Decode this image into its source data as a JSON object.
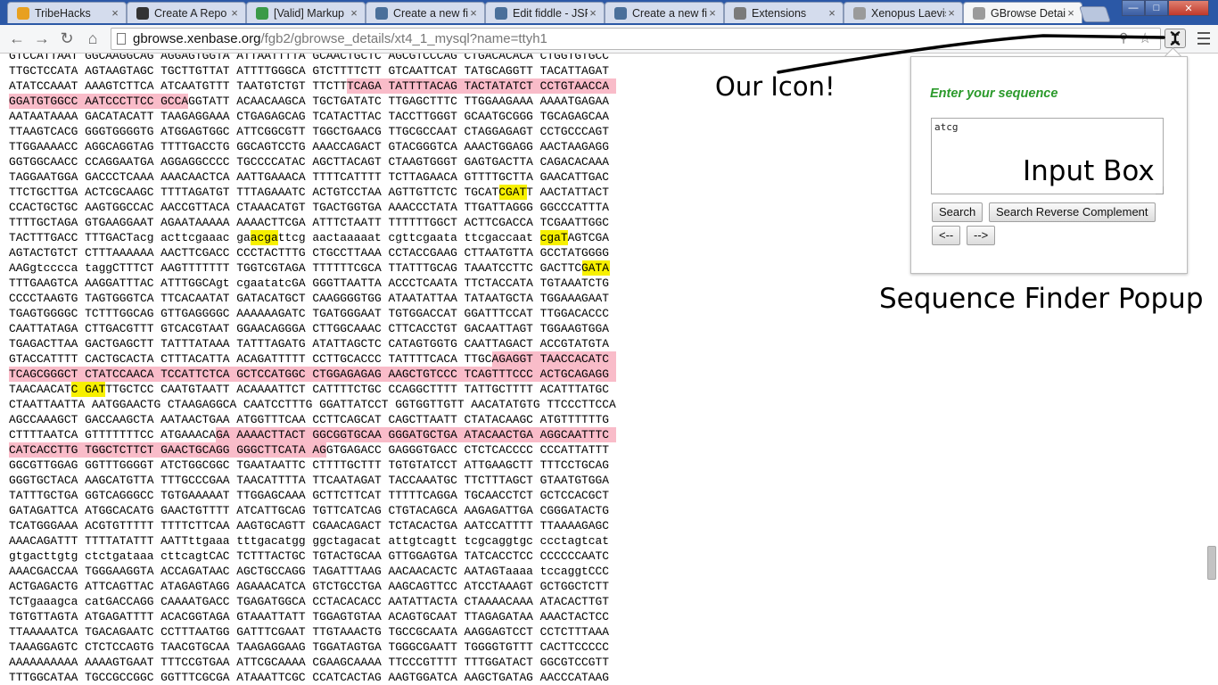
{
  "tabs": [
    {
      "title": "TribeHacks",
      "icon": "tribehacks-icon",
      "color": "#e8a020"
    },
    {
      "title": "Create A Repo",
      "icon": "github-icon",
      "color": "#333333"
    },
    {
      "title": "[Valid] Markup",
      "icon": "w3c-validator-icon",
      "color": "#3a9a48"
    },
    {
      "title": "Create a new fiddle",
      "icon": "jsfiddle-icon",
      "color": "#4a6f9a"
    },
    {
      "title": "Edit fiddle - JSFiddle",
      "icon": "jsfiddle-icon",
      "color": "#4a6f9a"
    },
    {
      "title": "Create a new fiddle",
      "icon": "jsfiddle-icon",
      "color": "#4a6f9a"
    },
    {
      "title": "Extensions",
      "icon": "puzzle-icon",
      "color": "#7a7a7a"
    },
    {
      "title": "Xenopus Laevis",
      "icon": "page-icon",
      "color": "#9a9a9a"
    },
    {
      "title": "GBrowse Details",
      "icon": "page-icon",
      "color": "#9a9a9a"
    }
  ],
  "omnibox": {
    "host": "gbrowse.xenbase.org",
    "path": "/fgb2/gbrowse_details/xt4_1_mysql?name=ttyh1"
  },
  "popup": {
    "heading": "Enter your sequence",
    "input_value": "atcg",
    "search_label": "Search",
    "search_rc_label": "Search Reverse Complement",
    "prev_label": "<--",
    "next_label": "-->"
  },
  "annotations": {
    "icon_label": "Our Icon!",
    "input_label": "Input Box",
    "popup_label": "Sequence Finder Popup"
  },
  "colors": {
    "pink_highlight": "#f9bcc9",
    "yellow_highlight": "#f7f000",
    "heading_green": "#2b9a2b"
  },
  "sequence": {
    "lines": [
      {
        "text": "GTCCATTAAT GGCAAGGCAG AGGAGTGGTA ATTAATTTTA GCAACTGCTC AGCGTCCCAG CTGACACACA CTGGTGTGCC",
        "hl": []
      },
      {
        "text": "TTGCTCCATA AGTAAGTAGC TGCTTGTTAT ATTTTGGGCA GTCTTTTCTT GTCAATTCAT TATGCAGGTT TACATTAGAT",
        "hl": []
      },
      {
        "text": "ATATCCAAAT AAAGTCTTCA ATCAATGTTT TAATGTCTGT TTCTTTCAGA TATTTTACAG TACTATATCT CCTGTAACCA",
        "hl": [
          [
            49,
            88,
            "pink"
          ]
        ]
      },
      {
        "text": "GGATGTGGCC AATCCCTTCC GCCAGGTATT ACAACAAGCA TGCTGATATC TTGAGCTTTC TTGGAAGAAA AAAATGAGAA",
        "hl": [
          [
            0,
            26,
            "pink"
          ]
        ]
      },
      {
        "text": "AATAATAAAA GACATACATT TAAGAGGAAA CTGAGAGCAG TCATACTTAC TACCTTGGGT GCAATGCGGG TGCAGAGCAA",
        "hl": []
      },
      {
        "text": "TTAAGTCACG GGGTGGGGTG ATGGAGTGGC ATTCGGCGTT TGGCTGAACG TTGCGCCAAT CTAGGAGAGT CCTGCCCAGT",
        "hl": []
      },
      {
        "text": "TTGGAAAACC AGGCAGGTAG TTTTGACCTG GGCAGTCCTG AAACCAGACT GTACGGGTCA AAACTGGAGG AACTAAGAGG",
        "hl": []
      },
      {
        "text": "GGTGGCAACC CCAGGAATGA AGGAGGCCCC TGCCCCATAC AGCTTACAGT CTAAGTGGGT GAGTGACTTA CAGACACAAA",
        "hl": []
      },
      {
        "text": "TAGGAATGGA GACCCTCAAA AAACAACTCA AATTGAAACA TTTTCATTTT TCTTAGAACA GTTTTGCTTA GAACATTGAC",
        "hl": []
      },
      {
        "text": "TTCTGCTTGA ACTCGCAAGC TTTTAGATGT TTTAGAAATC ACTGTCCTAA AGTTGTTCTC TGCATCGATT AACTATTACT",
        "hl": [
          [
            71,
            75,
            "yellow"
          ]
        ]
      },
      {
        "text": "CCACTGCTGC AAGTGGCCAC AACCGTTACA CTAAACATGT TGACTGGTGA AAACCCTATA TTGATTAGGG GGCCCATTTA",
        "hl": []
      },
      {
        "text": "TTTTGCTAGA GTGAAGGAAT AGAATAAAAA AAAACTTCGA ATTTCTAATT TTTTTTGGCT ACTTCGACCA TCGAATTGGC",
        "hl": []
      },
      {
        "text": "TACTTTGACC TTTGACTacg acttcgaaac gaacgattcg aactaaaaat cgttcgaata ttcgaccaat cgaTAGTCGA",
        "hl": [
          [
            35,
            39,
            "yellow"
          ],
          [
            77,
            81,
            "yellow"
          ]
        ]
      },
      {
        "text": "AGTACTGTCT CTTTAAAAAA AACTTCGACC CCCTACTTTG CTGCCTTAAA CCTACCGAAG CTTAATGTTA GCCTATGGGG",
        "hl": []
      },
      {
        "text": "AAGgtcccca taggCTTTCT AAGTTTTTTT TGGTCGTAGA TTTTTTCGCA TTATTTGCAG TAAATCCTTC GACTTCGATA",
        "hl": [
          [
            83,
            87,
            "yellow"
          ]
        ]
      },
      {
        "text": "TTTGAAGTCA AAGGATTTAC ATTTGGCAgt cgaatatcGA GGGTTAATTA ACCCTCAATA TTCTACCATA TGTAAATCTG",
        "hl": []
      },
      {
        "text": "CCCCTAAGTG TAGTGGGTCA TTCACAATAT GATACATGCT CAAGGGGTGG ATAATATTAA TATAATGCTA TGGAAAGAAT",
        "hl": []
      },
      {
        "text": "TGAGTGGGGC TCTTTGGCAG GTTGAGGGGC AAAAAAGATC TGATGGGAAT TGTGGACCAT GGATTTCCAT TTGGACACCC",
        "hl": []
      },
      {
        "text": "CAATTATAGA CTTGACGTTT GTCACGTAAT GGAACAGGGA CTTGGCAAAC CTTCACCTGT GACAATTAGT TGGAAGTGGA",
        "hl": []
      },
      {
        "text": "TGAGACTTAA GACTGAGCTT TATTTATAAA TATTTAGATG ATATTAGCTC CATAGTGGTG CAATTAGACT ACCGTATGTA",
        "hl": []
      },
      {
        "text": "GTACCATTTT CACTGCACTA CTTTACATTA ACAGATTTTT CCTTGCACCC TATTTTCACA TTGCAGAGGT TAACCACATC",
        "hl": [
          [
            70,
            88,
            "pink"
          ]
        ]
      },
      {
        "text": "TCAGCGGGCT CTATCCAACA TCCATTCTCA GCTCCATGGC CTGGAGAGAG AAGCTGTCCC TCAGTTTCCC ACTGCAGAGG",
        "hl": [
          [
            0,
            88,
            "pink"
          ]
        ]
      },
      {
        "text": "TAACAACATC GATTTGCTCC CAATGTAATT ACAAAATTCT CATTTTCTGC CCAGGCTTTT TATTGCTTTT ACATTTATGC",
        "hl": [
          [
            9,
            14,
            "yellow"
          ]
        ]
      },
      {
        "text": "CTAATTAATTA AATGGAACTG CTAAGAGGCA CAATCCTTTG GGATTATCCT GGTGGTTGTT AACATATGTG TTCCCTTCCA",
        "hl": []
      },
      {
        "text": "AGCCAAAGCT GACCAAGCTA AATAACTGAA ATGGTTTCAA CCTTCAGCAT CAGCTTAATT CTATACAAGC ATGTTTTTTG",
        "hl": []
      },
      {
        "text": "CTTTTAATCA GTTTTTTTCC ATGAAACAGA AAAACTTACT GGCGGTGCAA GGGATGCTGA ATACAACTGA AGGCAATTTC",
        "hl": [
          [
            30,
            88,
            "pink"
          ]
        ]
      },
      {
        "text": "CATCACCTTG TGGCTCTTCT GAACTGCAGG GGGCTTCATA AGGTGAGACC GAGGGTGACC CTCTCACCCC CCCATTATTT",
        "hl": [
          [
            0,
            46,
            "pink"
          ]
        ]
      },
      {
        "text": "GGCGTTGGAG GGTTTGGGGT ATCTGGCGGC TGAATAATTC CTTTTGCTTT TGTGTATCCT ATTGAAGCTT TTTCCTGCAG",
        "hl": []
      },
      {
        "text": "GGGTGCTACA AAGCATGTTA TTTGCCCGAA TAACATTTTA TTCAATAGAT TACCAAATGC TTCTTTAGCT GTAATGTGGA",
        "hl": []
      },
      {
        "text": "TATTTGCTGA GGTCAGGGCC TGTGAAAAAT TTGGAGCAAA GCTTCTTCAT TTTTTCAGGA TGCAACCTCT GCTCCACGCT",
        "hl": []
      },
      {
        "text": "GATAGATTCA ATGGCACATG GAACTGTTTT ATCATTGCAG TGTTCATCAG CTGTACAGCA AAGAGATTGA CGGGATACTG",
        "hl": []
      },
      {
        "text": "TCATGGGAAA ACGTGTTTTT TTTTCTTCAA AAGTGCAGTT CGAACAGACT TCTACACTGA AATCCATTTT TTAAAAGAGC",
        "hl": []
      },
      {
        "text": "AAACAGATTT TTTTATATTT AATTttgaaa tttgacatgg ggctagacat attgtcagtt tcgcaggtgc ccctagtcat",
        "hl": []
      },
      {
        "text": "gtgacttgtg ctctgataaa cttcagtCAC TCTTTACTGC TGTACTGCAA GTTGGAGTGA TATCACCTCC CCCCCCAATC",
        "hl": []
      },
      {
        "text": "AAACGACCAA TGGGAAGGTA ACCAGATAAC AGCTGCCAGG TAGATTTAAG AACAACACTC AATAGTaaaa tccaggtCCC",
        "hl": []
      },
      {
        "text": "ACTGAGACTG ATTCAGTTAC ATAGAGTAGG AGAAACATCA GTCTGCCTGA AAGCAGTTCC ATCCTAAAGT GCTGGCTCTT",
        "hl": []
      },
      {
        "text": "TCTgaaagca catGACCAGG CAAAATGACC TGAGATGGCA CCTACACACC AATATTACTA CTAAAACAAA ATACACTTGT",
        "hl": []
      },
      {
        "text": "TGTGTTAGTA ATGAGATTTT ACACGGTAGA GTAAATTATT TGGAGTGTAA ACAGTGCAAT TTAGAGATAA AAACTACTCC",
        "hl": []
      },
      {
        "text": "TTAAAAATCA TGACAGAATC CCTTTAATGG GATTTCGAAT TTGTAAACTG TGCCGCAATA AAGGAGTCCT CCTCTTTAAA",
        "hl": []
      },
      {
        "text": "TAAAGGAGTC CTCTCCAGTG TAACGTGCAA TAAGAGGAAG TGGATAGTGA TGGGCGAATT TGGGGTGTTT CACTTCCCCC",
        "hl": []
      },
      {
        "text": "AAAAAAAAAA AAAAGTGAAT TTTCCGTGAA ATTCGCAAAA CGAAGCAAAA TTCCCGTTTT TTTGGATACT GGCGTCCGTT",
        "hl": []
      },
      {
        "text": "TTTGGCATAA TGCCGCCGGC GGTTTCGCGA ATAAATTCGC CCATCACTAG AAGTGGATCA AAGCTGATAG AACCCATAAG",
        "hl": []
      }
    ]
  }
}
